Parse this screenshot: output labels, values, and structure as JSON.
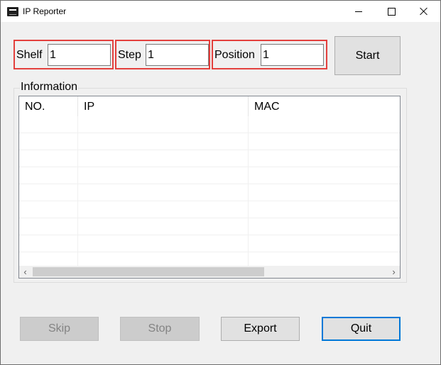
{
  "window": {
    "title": "IP Reporter"
  },
  "title_buttons": {
    "minimize_icon": "minimize-icon",
    "maximize_icon": "maximize-icon",
    "close_icon": "close-icon"
  },
  "fields": {
    "shelf": {
      "label": "Shelf",
      "value": "1"
    },
    "step": {
      "label": "Step",
      "value": "1"
    },
    "position": {
      "label": "Position",
      "value": "1"
    }
  },
  "buttons": {
    "start": "Start",
    "skip": "Skip",
    "stop": "Stop",
    "export": "Export",
    "quit": "Quit"
  },
  "information": {
    "group_label": "Information",
    "columns": [
      "NO.",
      "IP",
      "MAC"
    ],
    "rows": []
  },
  "colors": {
    "highlight_border": "#e3403d",
    "focus_border": "#0078d7",
    "window_bg": "#f0f0f0"
  }
}
